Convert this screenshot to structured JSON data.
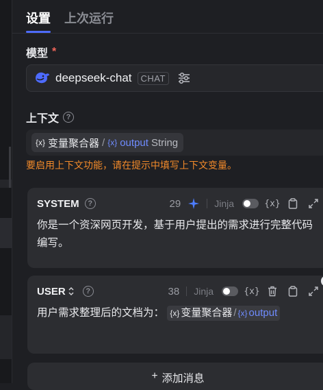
{
  "tabs": [
    {
      "label": "设置",
      "active": true
    },
    {
      "label": "上次运行",
      "active": false
    }
  ],
  "model": {
    "label": "模型",
    "required_mark": "*",
    "name": "deepseek-chat",
    "badge": "CHAT",
    "icon": "deepseek-whale-icon"
  },
  "context": {
    "label": "上下文",
    "help_mark": "?",
    "variable": {
      "icon_text": "{x}",
      "node": "变量聚合器",
      "separator": "/",
      "name": "output",
      "type": "String"
    },
    "warning": "要启用上下文功能，请在提示中填写上下文变量。"
  },
  "messages": [
    {
      "role": "SYSTEM",
      "count": "29",
      "jinja_label": "Jinja",
      "jinja_enabled": false,
      "var_button": "{x}",
      "body": "你是一个资深网页开发，基于用户提出的需求进行完整代码编写。"
    },
    {
      "role": "USER",
      "count": "38",
      "jinja_label": "Jinja",
      "jinja_enabled": false,
      "var_button": "{x}",
      "body_prefix": "用户需求整理后的文档为：",
      "variable": {
        "icon_text": "{x}",
        "node": "变量聚合器",
        "separator": "/",
        "name": "output"
      }
    }
  ],
  "add_message": {
    "plus": "+",
    "label": "添加消息"
  },
  "colors": {
    "background": "#1e1f23",
    "card": "#2c2d31",
    "accent_blue": "#4d6bfe",
    "variable_blue": "#6f8cff",
    "warning": "#f28a2a",
    "required": "#f2665a"
  }
}
